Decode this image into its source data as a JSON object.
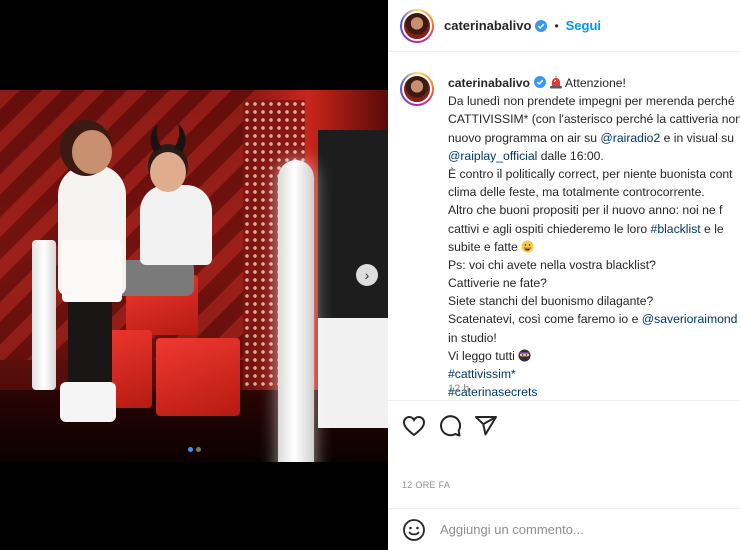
{
  "post": {
    "username": "caterinabalivo",
    "follow_label": "Segui",
    "separator": "•",
    "caption": {
      "lines": [
        {
          "parts": [
            {
              "t": "Attenzione!"
            }
          ],
          "first": true
        },
        {
          "parts": [
            {
              "t": "Da lunedì non prendete impegni per merenda perché"
            }
          ]
        },
        {
          "parts": [
            {
              "t": "CATTIVISSIM* (con l'asterisco perché la cattiveria non"
            }
          ]
        },
        {
          "parts": [
            {
              "t": "nuovo programma on air su "
            },
            {
              "t": "@rairadio2",
              "tag": true
            },
            {
              "t": " e in visual su"
            }
          ]
        },
        {
          "parts": [
            {
              "t": "@raiplay_official",
              "tag": true
            },
            {
              "t": " dalle 16:00."
            }
          ]
        },
        {
          "parts": [
            {
              "t": "È contro il politically correct, per niente buonista cont"
            }
          ]
        },
        {
          "parts": [
            {
              "t": "clima delle feste, ma totalmente controcorrente."
            }
          ]
        },
        {
          "parts": [
            {
              "t": "Altro che buoni propositi per il nuovo anno: noi ne f"
            }
          ]
        },
        {
          "parts": [
            {
              "t": "cattivi e agli ospiti chiederemo le loro "
            },
            {
              "t": "#blacklist",
              "tag": true
            },
            {
              "t": " e le"
            }
          ]
        },
        {
          "parts": [
            {
              "t": "subite e fatte "
            }
          ],
          "emoji": "grin"
        },
        {
          "parts": [
            {
              "t": "Ps: voi chi avete nella vostra blacklist?"
            }
          ]
        },
        {
          "parts": [
            {
              "t": "Cattiverie ne fate?"
            }
          ]
        },
        {
          "parts": [
            {
              "t": "Siete stanchi del buonismo dilagante?"
            }
          ]
        },
        {
          "parts": [
            {
              "t": "Scatenatevi, così come faremo io e "
            },
            {
              "t": "@saverioraimond",
              "tag": true
            }
          ]
        },
        {
          "parts": [
            {
              "t": "in studio!"
            }
          ]
        },
        {
          "parts": [
            {
              "t": "Vi leggo tutti "
            }
          ],
          "emoji": "ninja"
        },
        {
          "parts": [
            {
              "t": "#cattivissim*",
              "tag": true
            }
          ]
        },
        {
          "parts": [
            {
              "t": "#caterinasecrets",
              "tag": true
            }
          ]
        }
      ]
    },
    "caption_time": "12 h",
    "timestamp": "12 ORE FA",
    "comment_placeholder": "Aggiungi un commento...",
    "carousel": {
      "slides": 2,
      "current": 1
    }
  },
  "icons": {
    "verified": "verified-badge-icon",
    "alarm": "police-light-emoji",
    "like": "heart-icon",
    "comment": "comment-bubble-icon",
    "share": "paper-plane-icon",
    "emoji": "smiley-icon",
    "next": "chevron-right-icon"
  },
  "colors": {
    "link": "#00376b",
    "follow": "#0095f6",
    "muted": "#8e8e8e",
    "text": "#262626",
    "dot_active": "#3897f0"
  }
}
